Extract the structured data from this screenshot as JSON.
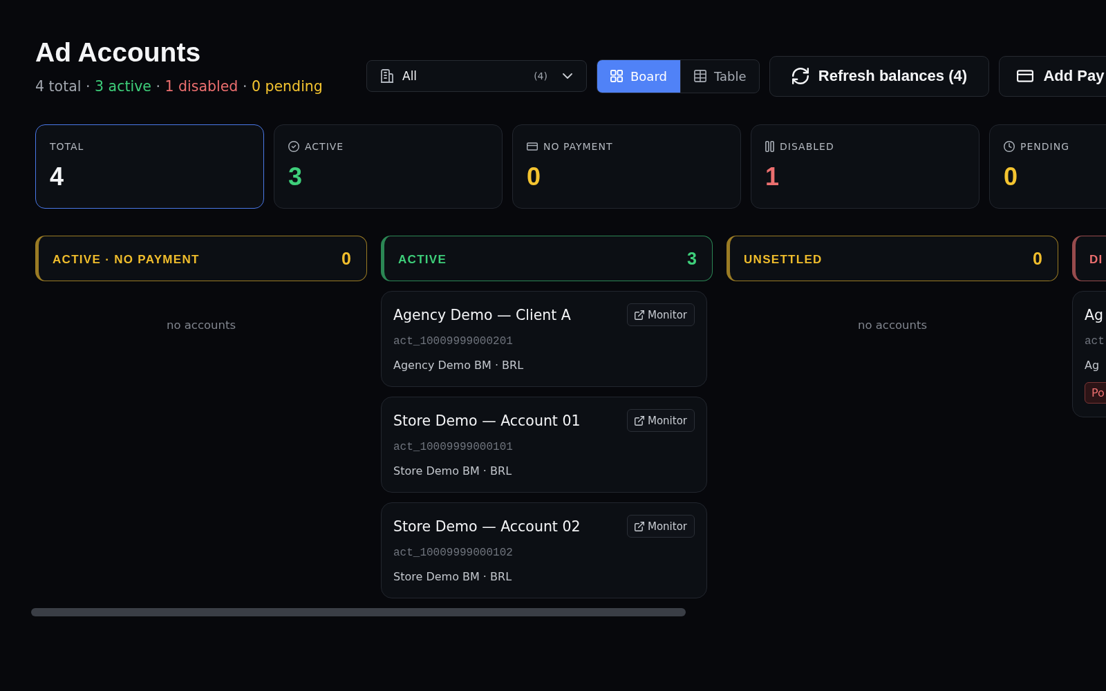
{
  "header": {
    "title": "Ad Accounts",
    "summary": [
      {
        "kind": "count",
        "text": "4 total",
        "color": "#a1a6ae"
      },
      {
        "kind": "separator",
        "text": "·"
      },
      {
        "kind": "count",
        "text": "3 active",
        "color": "#3ecf7a"
      },
      {
        "kind": "separator",
        "text": "·"
      },
      {
        "kind": "count",
        "text": "1 disabled",
        "color": "#ec6f6f"
      },
      {
        "kind": "separator",
        "text": "·"
      },
      {
        "kind": "count",
        "text": "0 pending",
        "color": "#f4c430"
      }
    ]
  },
  "toolbar": {
    "filter": {
      "label": "All",
      "count": "(4)"
    },
    "view_toggle": [
      {
        "kind": "board",
        "label": "Board",
        "selected": true
      },
      {
        "kind": "table",
        "label": "Table",
        "selected": false
      }
    ],
    "buttons": [
      {
        "kind": "refresh",
        "label": "Refresh balances (4)"
      },
      {
        "kind": "payment",
        "label": "Add Pay"
      }
    ]
  },
  "stats": [
    {
      "kind": "total",
      "label": "TOTAL",
      "value": "4",
      "color": "#f4f5f7",
      "selected": true
    },
    {
      "kind": "active",
      "label": "ACTIVE",
      "value": "3",
      "color": "#3ecf7a",
      "selected": false
    },
    {
      "kind": "no_payment",
      "label": "NO PAYMENT",
      "value": "0",
      "color": "#f4c430",
      "selected": false
    },
    {
      "kind": "disabled",
      "label": "DISABLED",
      "value": "1",
      "color": "#ec6f6f",
      "selected": false
    },
    {
      "kind": "pending",
      "label": "PENDING",
      "value": "0",
      "color": "#f4c430",
      "selected": false
    }
  ],
  "columns": [
    {
      "title": "ACTIVE · NO PAYMENT",
      "count": "0",
      "color": "#f0bd2c",
      "empty_text": "no accounts"
    },
    {
      "title": "ACTIVE",
      "count": "3",
      "color": "#3ecf7a",
      "accounts": [
        {
          "name": "Agency Demo — Client A",
          "account_id": "act_10009999000201",
          "business": "Agency Demo BM · BRL",
          "action": "Monitor"
        },
        {
          "name": "Store Demo — Account 01",
          "account_id": "act_10009999000101",
          "business": "Store Demo BM · BRL",
          "action": "Monitor"
        },
        {
          "name": "Store Demo — Account 02",
          "account_id": "act_10009999000102",
          "business": "Store Demo BM · BRL",
          "action": "Monitor"
        }
      ]
    },
    {
      "title": "UNSETTLED",
      "count": "0",
      "color": "#f0bd2c",
      "empty_text": "no accounts"
    },
    {
      "title": "DI",
      "color": "#ec6f6f",
      "accounts": [
        {
          "name": "Ag",
          "account_id": "act",
          "business": "Ag",
          "tag": "Po"
        }
      ]
    }
  ]
}
